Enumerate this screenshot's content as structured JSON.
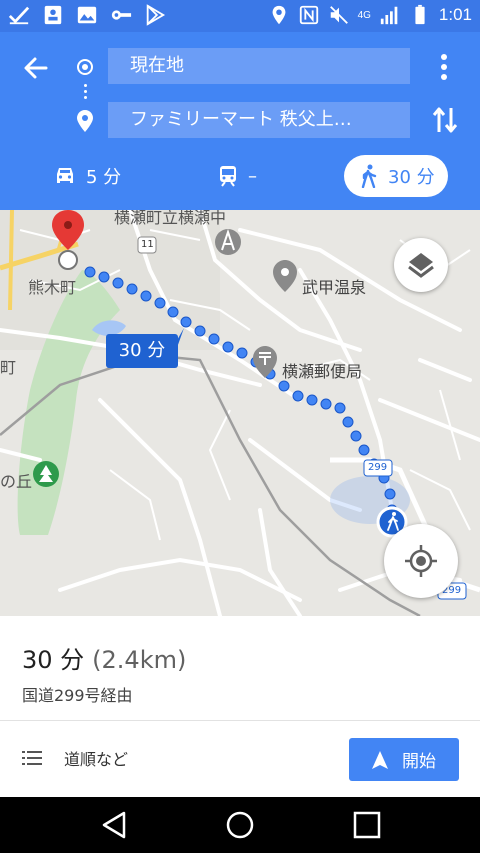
{
  "status_bar": {
    "time": "1:01",
    "network": "4G",
    "icons_left": [
      "check-icon",
      "contact-card-icon",
      "image-icon",
      "key-icon",
      "play-store-icon"
    ],
    "icons_right": [
      "location-icon",
      "nfc-icon",
      "mute-icon",
      "signal-icon",
      "battery-icon"
    ]
  },
  "directions": {
    "origin": "現在地",
    "destination": "ファミリーマート 秩父上…",
    "modes": [
      {
        "name": "car",
        "label": "5 分"
      },
      {
        "name": "transit",
        "label": "–"
      },
      {
        "name": "walk",
        "label": "30 分",
        "selected": true
      }
    ]
  },
  "map": {
    "labels": {
      "school": "横瀬町立横瀬中",
      "town": "熊木町",
      "onsen": "武甲温泉",
      "post_office": "横瀬郵便局",
      "hill": "の丘",
      "route_11": "11",
      "route_299a": "299",
      "route_299b": "299",
      "town_cut": "町"
    },
    "duration_tag": "30 分",
    "colors": {
      "route_dots": "#4285f4",
      "destination_pin": "#e53935",
      "park": "#c5e2bf",
      "water": "#a7c6f5"
    }
  },
  "summary": {
    "duration": "30 分",
    "distance": "(2.4km)",
    "via": "国道299号経由",
    "steps_label": "道順など",
    "start_label": "開始"
  },
  "accent": "#4285f4"
}
